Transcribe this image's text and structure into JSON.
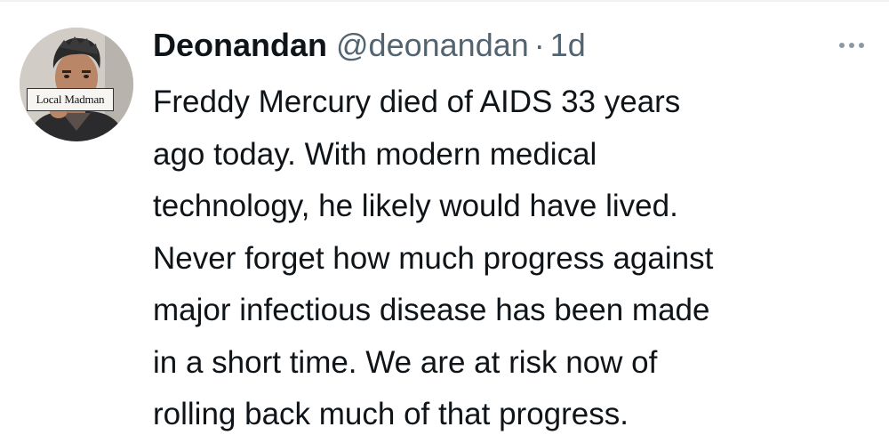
{
  "tweet": {
    "avatar": {
      "caption": "Local Madman",
      "icon": "profile-photo"
    },
    "author": {
      "display_name": "Deonandan",
      "handle": "@deonandan"
    },
    "separator": "·",
    "timestamp": "1d",
    "more_icon": "more-horizontal-icon",
    "text_lines": [
      "Freddy Mercury died of AIDS 33 years",
      "ago today. With modern medical",
      "technology, he likely would have lived.",
      "Never forget how much progress against",
      "major infectious disease has been made",
      "in a short time. We are at risk now of",
      "rolling back much of that progress."
    ]
  },
  "colors": {
    "text_primary": "#0f1419",
    "text_secondary": "#536471",
    "background": "#ffffff"
  }
}
